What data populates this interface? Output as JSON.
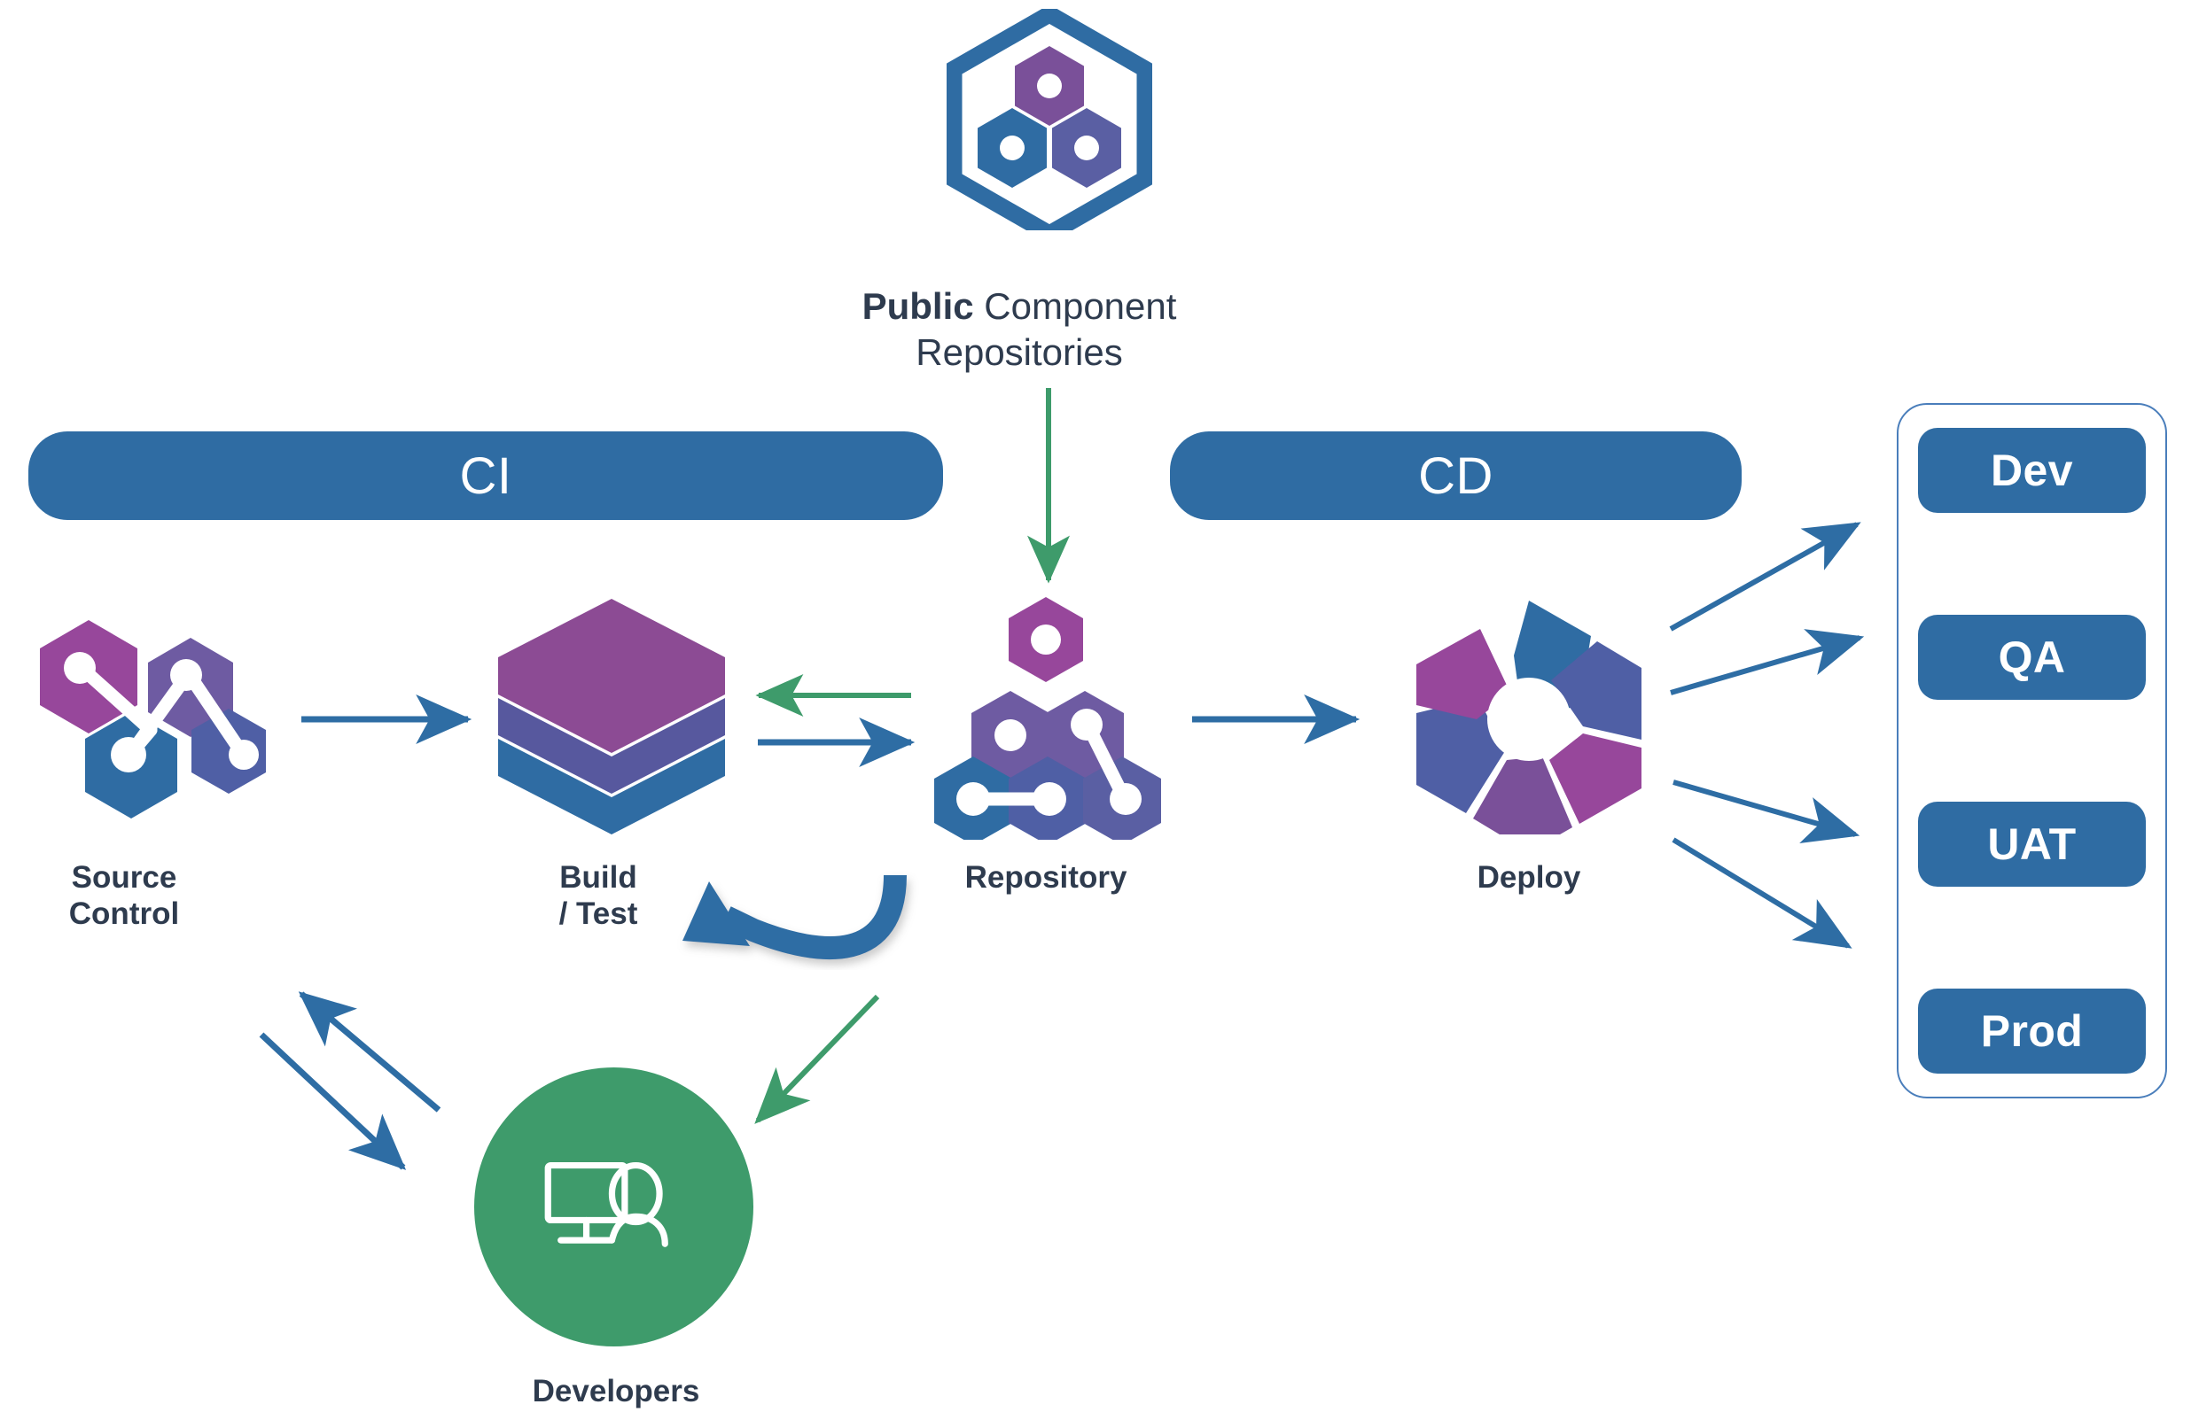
{
  "diagram": {
    "title_caption": {
      "bold_part": "Public",
      "rest_part": " Component",
      "line2": "Repositories"
    },
    "phases": [
      {
        "id": "ci",
        "label": "CI"
      },
      {
        "id": "cd",
        "label": "CD"
      }
    ],
    "nodes": [
      {
        "id": "source-control",
        "label": "Source\nControl",
        "icon": "hexagon-network-icon"
      },
      {
        "id": "build-test",
        "label": "Build\n/ Test",
        "icon": "layered-hexagon-icon"
      },
      {
        "id": "repository",
        "label": "Repository",
        "icon": "hexagon-cluster-icon"
      },
      {
        "id": "deploy",
        "label": "Deploy",
        "icon": "pinwheel-hexagon-icon"
      },
      {
        "id": "developers",
        "label": "Developers",
        "icon": "developer-monitor-icon"
      },
      {
        "id": "public-repos",
        "label": "",
        "icon": "hexagon-honeycomb-icon"
      }
    ],
    "environments": [
      {
        "id": "dev",
        "label": "Dev"
      },
      {
        "id": "qa",
        "label": "QA"
      },
      {
        "id": "uat",
        "label": "UAT"
      },
      {
        "id": "prod",
        "label": "Prod"
      }
    ],
    "connections": [
      {
        "id": "public-to-repository",
        "from": "public-repos",
        "to": "repository",
        "color": "green",
        "style": "straight-down"
      },
      {
        "id": "source-to-build",
        "from": "source-control",
        "to": "build-test",
        "color": "blue",
        "style": "straight-right"
      },
      {
        "id": "repository-to-build",
        "from": "repository",
        "to": "build-test",
        "color": "green",
        "style": "straight-left"
      },
      {
        "id": "build-to-repository",
        "from": "build-test",
        "to": "repository",
        "color": "blue",
        "style": "straight-right"
      },
      {
        "id": "repository-loop-to-build",
        "from": "repository",
        "to": "build-test",
        "color": "blue",
        "style": "curved-loop"
      },
      {
        "id": "repository-to-deploy",
        "from": "repository",
        "to": "deploy",
        "color": "blue",
        "style": "straight-right"
      },
      {
        "id": "deploy-to-dev",
        "from": "deploy",
        "to": "dev",
        "color": "blue",
        "style": "diagonal-up"
      },
      {
        "id": "deploy-to-qa",
        "from": "deploy",
        "to": "qa",
        "color": "blue",
        "style": "diagonal-up"
      },
      {
        "id": "deploy-to-uat",
        "from": "deploy",
        "to": "uat",
        "color": "blue",
        "style": "diagonal-down"
      },
      {
        "id": "deploy-to-prod",
        "from": "deploy",
        "to": "prod",
        "color": "blue",
        "style": "diagonal-down"
      },
      {
        "id": "developers-to-source",
        "from": "developers",
        "to": "source-control",
        "color": "blue",
        "style": "diagonal-up-left"
      },
      {
        "id": "source-to-developers",
        "from": "source-control",
        "to": "developers",
        "color": "blue",
        "style": "diagonal-down-right"
      },
      {
        "id": "repository-to-developers",
        "from": "repository",
        "to": "developers",
        "color": "green",
        "style": "diagonal-down-left"
      }
    ],
    "colors": {
      "banner_blue": "#2F6CA3",
      "arrow_blue": "#2E6DA4",
      "arrow_green": "#3E9B6B",
      "text_navy": "#2E3B4E",
      "icon_magenta": "#97479B",
      "icon_purple": "#6E5BA2",
      "icon_indigo": "#4F5FA5",
      "icon_blue": "#2F6CA3",
      "developers_green": "#3E9B6B",
      "panel_border": "#4A7EBB",
      "white": "#FFFFFF"
    }
  }
}
